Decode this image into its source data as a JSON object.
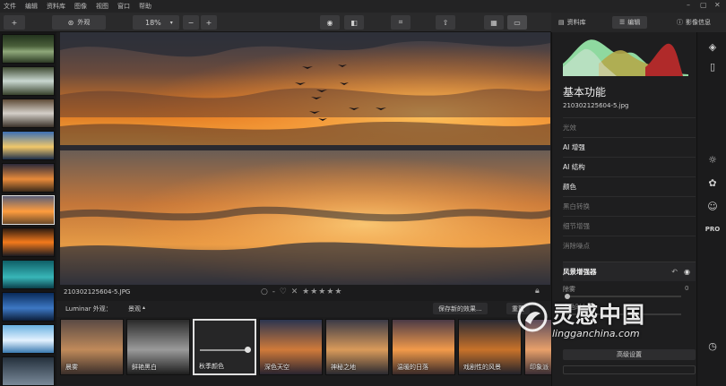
{
  "menu": [
    "文件",
    "编辑",
    "资料库",
    "图像",
    "视图",
    "窗口",
    "帮助"
  ],
  "toolbar": {
    "add_label": "+",
    "looks_label": "外观",
    "zoom": "18%",
    "zoom_minus": "−",
    "zoom_plus": "+"
  },
  "panel_tabs": {
    "library_label": "资料库",
    "edit_label": "编辑",
    "info_label": "影像信息"
  },
  "canvas": {
    "filename": "210302125604-5.JPG",
    "rating_tools": "○ - ♡ ✕ ★★★★★"
  },
  "looks_bar": {
    "title": "Luminar 外观：",
    "category": "景观",
    "save_label": "保存新的效果...",
    "reset_label": "重置"
  },
  "looks": [
    {
      "name": "晨雾"
    },
    {
      "name": "鲜艳黑白"
    },
    {
      "name": "秋季颜色"
    },
    {
      "name": "深色天空"
    },
    {
      "name": "神秘之地"
    },
    {
      "name": "温暖的日落"
    },
    {
      "name": "戏剧性的风景"
    },
    {
      "name": "印象派"
    }
  ],
  "panel": {
    "title": "基本功能",
    "file": "210302125604-5.jpg",
    "tools": [
      {
        "label": "光效",
        "state": "dim"
      },
      {
        "label": "AI 增强",
        "state": "active"
      },
      {
        "label": "AI 结构",
        "state": "active"
      },
      {
        "label": "颜色",
        "state": "active"
      },
      {
        "label": "黑白转换",
        "state": "dim"
      },
      {
        "label": "细节增强",
        "state": "dim"
      },
      {
        "label": "消除噪点",
        "state": "dim"
      }
    ],
    "expanded_tool": "风景增强器",
    "slider1_label": "除雾",
    "slider1_value": "0",
    "slider2_label": "金色时刻",
    "advanced_label": "高级设置"
  },
  "watermark": {
    "cn": "灵感中国",
    "url": "lingganchina.com"
  },
  "colors": {
    "accent": "#ffffff",
    "panel_bg": "#1e1e1f",
    "histogram_green": "#8fd9a0",
    "histogram_red": "#b02a2a",
    "histogram_yellow": "#b3a84a"
  }
}
